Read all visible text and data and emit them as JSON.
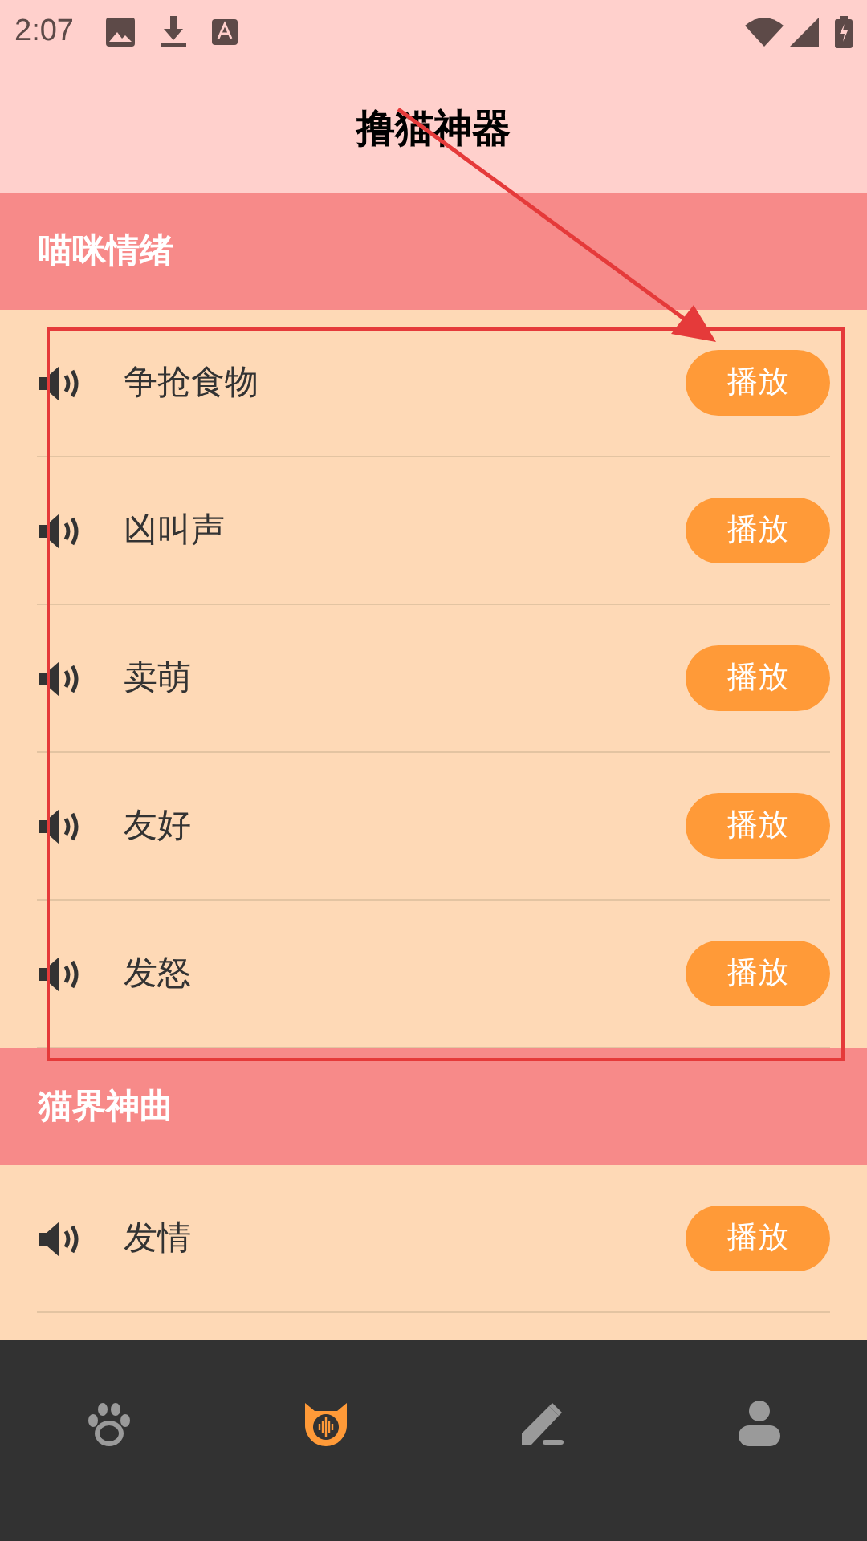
{
  "status_bar": {
    "time": "2:07"
  },
  "app_bar": {
    "title": "撸猫神器"
  },
  "sections": [
    {
      "title": "喵咪情绪",
      "items": [
        {
          "name": "争抢食物",
          "button": "播放"
        },
        {
          "name": "凶叫声",
          "button": "播放"
        },
        {
          "name": "卖萌",
          "button": "播放"
        },
        {
          "name": "友好",
          "button": "播放"
        },
        {
          "name": "发怒",
          "button": "播放"
        }
      ]
    },
    {
      "title": "猫界神曲",
      "items": [
        {
          "name": "发情",
          "button": "播放"
        }
      ]
    }
  ],
  "bottom_nav": [
    {
      "kind": "paw",
      "selected": false
    },
    {
      "kind": "cat",
      "selected": true
    },
    {
      "kind": "edit",
      "selected": false
    },
    {
      "kind": "person",
      "selected": false
    }
  ]
}
